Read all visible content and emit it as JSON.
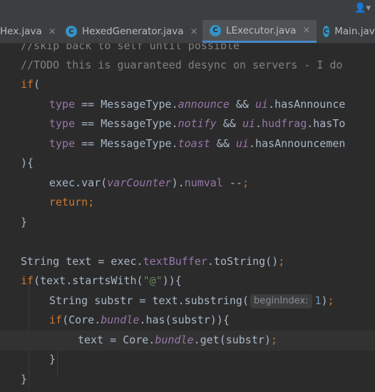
{
  "titlebar": {
    "user_icon": "user-icon",
    "user_dropdown_glyph": "▾"
  },
  "tabs": [
    {
      "label": "Hex.java",
      "icon": "",
      "active": false,
      "close": "×"
    },
    {
      "label": "HexedGenerator.java",
      "icon": "C",
      "active": false,
      "close": "×"
    },
    {
      "label": "LExecutor.java",
      "icon": "C",
      "active": true,
      "close": "×"
    },
    {
      "label": "Main.java",
      "icon": "C",
      "active": false,
      "close": ""
    }
  ],
  "code": {
    "l1": "//skip back to self until possible",
    "l2": "//TODO this is guaranteed desync on servers - I do",
    "if": "if",
    "paren_open": "(",
    "type": "type",
    "eqeq": " == ",
    "msgtype_dot": "MessageType.",
    "announce": "announce",
    "notify": "notify",
    "toast": "toast",
    "andand": " && ",
    "ui": "ui",
    "dot": ".",
    "hasAnnounce_frag": "hasAnnounce",
    "hudfrag": "hudfrag",
    "hasTo_frag": "hasTo",
    "hasAnnouncemen_frag": "hasAnnouncemen",
    "close_brace_open": "){",
    "exec_var_open": "exec.var(",
    "varCounter": "varCounter",
    "paren_close_dot": ").",
    "numval": "numval",
    "dec": " --",
    "semi": ";",
    "return": "return",
    "brace_close": "}",
    "string_type": "String",
    "text_assign": " text = exec.",
    "textBuffer": "textBuffer",
    "toString_call": ".toString()",
    "if_open": "if",
    "startsWith_frag": "(text.startsWith(",
    "at_string": "\"@\"",
    "close_parens_brace": ")){",
    "substr_decl": " substr = text.substring(",
    "hint_beginIndex": "beginIndex:",
    "one": "1",
    "paren_close": ")",
    "core_dot": "(Core.",
    "bundle": "bundle",
    "has_substr": ".has(substr)){",
    "text_eq_core": "text = Core.",
    "get": "get",
    "substr_arg": "(substr)"
  }
}
